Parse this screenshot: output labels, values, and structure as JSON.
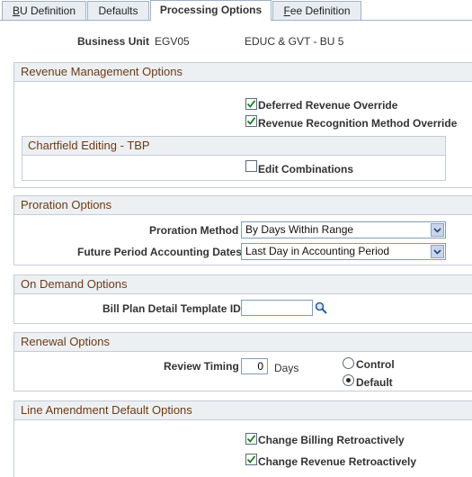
{
  "tabs": [
    {
      "pre": "",
      "ul": "B",
      "post": "U Definition",
      "active": false
    },
    {
      "pre": "",
      "ul": "",
      "post": "Defaults",
      "active": false
    },
    {
      "pre": "",
      "ul": "",
      "post": "Processing Options",
      "active": true
    },
    {
      "pre": "",
      "ul": "F",
      "post": "ee Definition",
      "active": false
    }
  ],
  "business_unit": {
    "label": "Business Unit",
    "code": "EGV05",
    "description": "EDUC & GVT - BU 5"
  },
  "revenue_management": {
    "title": "Revenue Management Options",
    "deferred_revenue_override": {
      "label": "Deferred Revenue Override",
      "checked": true
    },
    "revenue_recognition_override": {
      "label": "Revenue Recognition Method Override",
      "checked": true
    },
    "chartfield_editing": {
      "title": "Chartfield Editing - TBP",
      "edit_combinations": {
        "label": "Edit Combinations",
        "checked": false
      }
    }
  },
  "proration": {
    "title": "Proration Options",
    "method_label": "Proration Method",
    "method_value": "By Days Within Range",
    "future_dates_label": "Future Period Accounting Dates",
    "future_dates_value": "Last Day in Accounting Period"
  },
  "on_demand": {
    "title": "On Demand Options",
    "template_label": "Bill Plan Detail Template ID",
    "template_value": ""
  },
  "renewal": {
    "title": "Renewal Options",
    "review_timing_label": "Review Timing",
    "review_timing_value": "0",
    "days_label": "Days",
    "control_label": "Control",
    "default_label": "Default",
    "selected": "Default"
  },
  "line_amendment": {
    "title": "Line Amendment Default Options",
    "change_billing": {
      "label": "Change Billing Retroactively",
      "checked": true
    },
    "change_revenue": {
      "label": "Change Revenue Retroactively",
      "checked": true
    }
  }
}
